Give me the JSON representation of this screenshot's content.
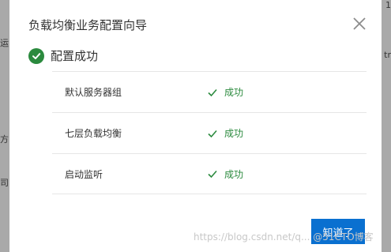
{
  "dialog": {
    "title": "负载均衡业务配置向导",
    "success_title": "配置成功",
    "ok_label": "知道了",
    "accent_color": "#0a70d0",
    "success_color": "#2b8a3e"
  },
  "results": [
    {
      "label": "默认服务器组",
      "status": "成功"
    },
    {
      "label": "七层负载均衡",
      "status": "成功"
    },
    {
      "label": "启动监听",
      "status": "成功"
    }
  ],
  "background": {
    "fragments": [
      "运",
      "方",
      "司",
      "tr",
      "1"
    ]
  },
  "watermark": "https://blog.csdn.net/q... @51CTO博客"
}
